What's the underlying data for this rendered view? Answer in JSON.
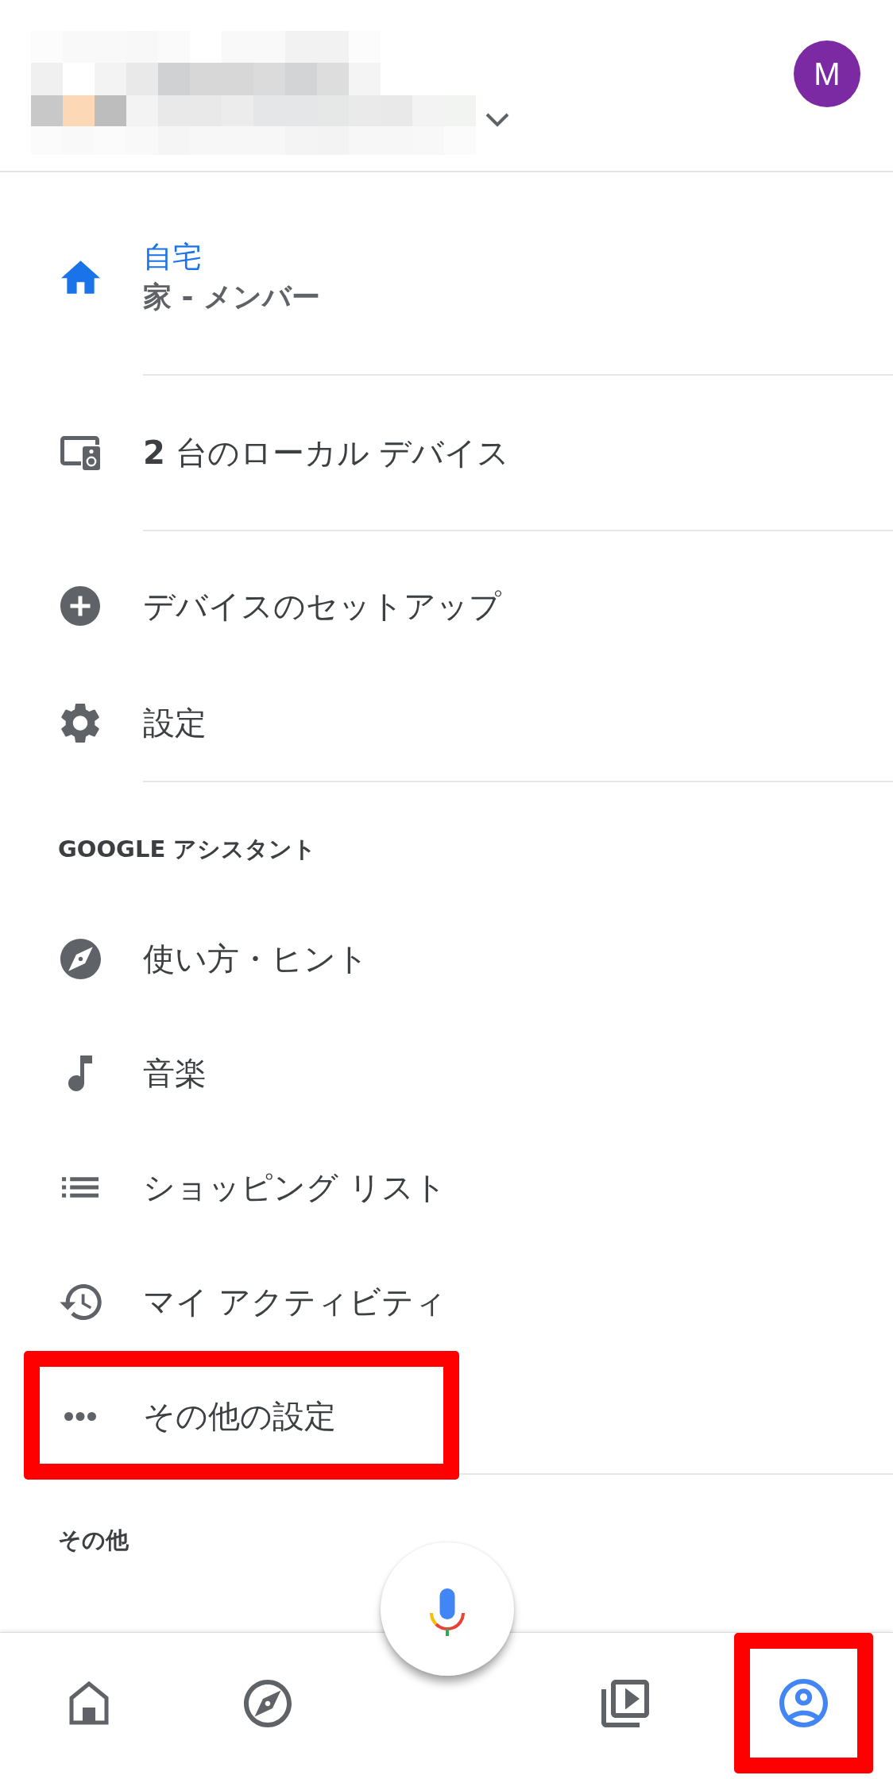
{
  "header": {
    "avatar_letter": "M"
  },
  "home": {
    "title": "自宅",
    "subtitle": "家 - メンバー"
  },
  "local_devices": {
    "label": "**2** 台のローカル デバイス"
  },
  "menu": [
    {
      "label": "デバイスのセットアップ"
    },
    {
      "label": "設定"
    }
  ],
  "assistant": {
    "heading": "GOOGLE アシスタント",
    "items": [
      {
        "label": "使い方・ヒント",
        "highlighted": false
      },
      {
        "label": "音楽",
        "highlighted": false
      },
      {
        "label": "ショッピング リスト",
        "highlighted": false
      },
      {
        "label": "マイ アクティビティ",
        "highlighted": false
      },
      {
        "label": "その他の設定",
        "highlighted": true
      }
    ]
  },
  "other": {
    "heading": "その他"
  },
  "bottom_nav": [
    {
      "selected": false,
      "highlighted": false
    },
    {
      "selected": false,
      "highlighted": false
    },
    {
      "selected": false,
      "highlighted": false
    },
    {
      "selected": true,
      "highlighted": true
    }
  ]
}
